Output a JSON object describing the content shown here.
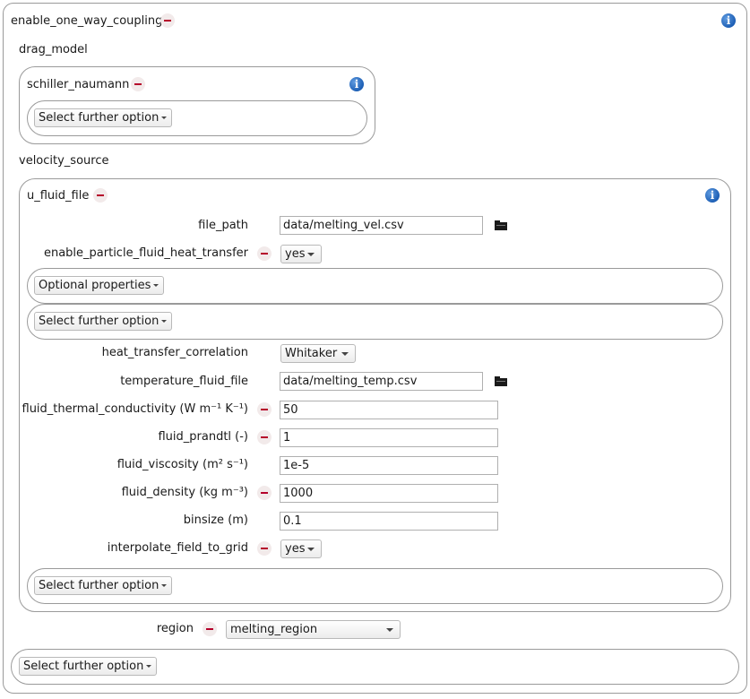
{
  "root": {
    "label": "enable_one_way_coupling"
  },
  "drag_model": {
    "heading": "drag_model",
    "label": "schiller_naumann",
    "further_option": "Select further option"
  },
  "velocity_source": {
    "heading": "velocity_source",
    "label": "u_fluid_file",
    "file_path": {
      "label": "file_path",
      "value": "data/melting_vel.csv"
    },
    "heat_transfer": {
      "label": "enable_particle_fluid_heat_transfer",
      "value": "yes"
    },
    "optional_properties": "Optional properties",
    "further_option_1": "Select further option",
    "correlation": {
      "label": "heat_transfer_correlation",
      "value": "Whitaker"
    },
    "temp_file": {
      "label": "temperature_fluid_file",
      "value": "data/melting_temp.csv"
    },
    "conductivity": {
      "label": "fluid_thermal_conductivity (W m⁻¹ K⁻¹)",
      "value": "50"
    },
    "prandtl": {
      "label": "fluid_prandtl (-)",
      "value": "1"
    },
    "viscosity": {
      "label": "fluid_viscosity (m² s⁻¹)",
      "value": "1e-5"
    },
    "density": {
      "label": "fluid_density (kg m⁻³)",
      "value": "1000"
    },
    "binsize": {
      "label": "binsize (m)",
      "value": "0.1"
    },
    "interpolate": {
      "label": "interpolate_field_to_grid",
      "value": "yes"
    },
    "further_option_2": "Select further option"
  },
  "region": {
    "label": "region",
    "value": "melting_region"
  },
  "bottom_further_option": "Select further option",
  "icons": {
    "remove": "remove-icon",
    "info": "info-icon",
    "folder": "folder-icon"
  },
  "colors": {
    "remove": "#b5002a",
    "info": "#1d5fb5",
    "border": "#9a9a9a"
  }
}
